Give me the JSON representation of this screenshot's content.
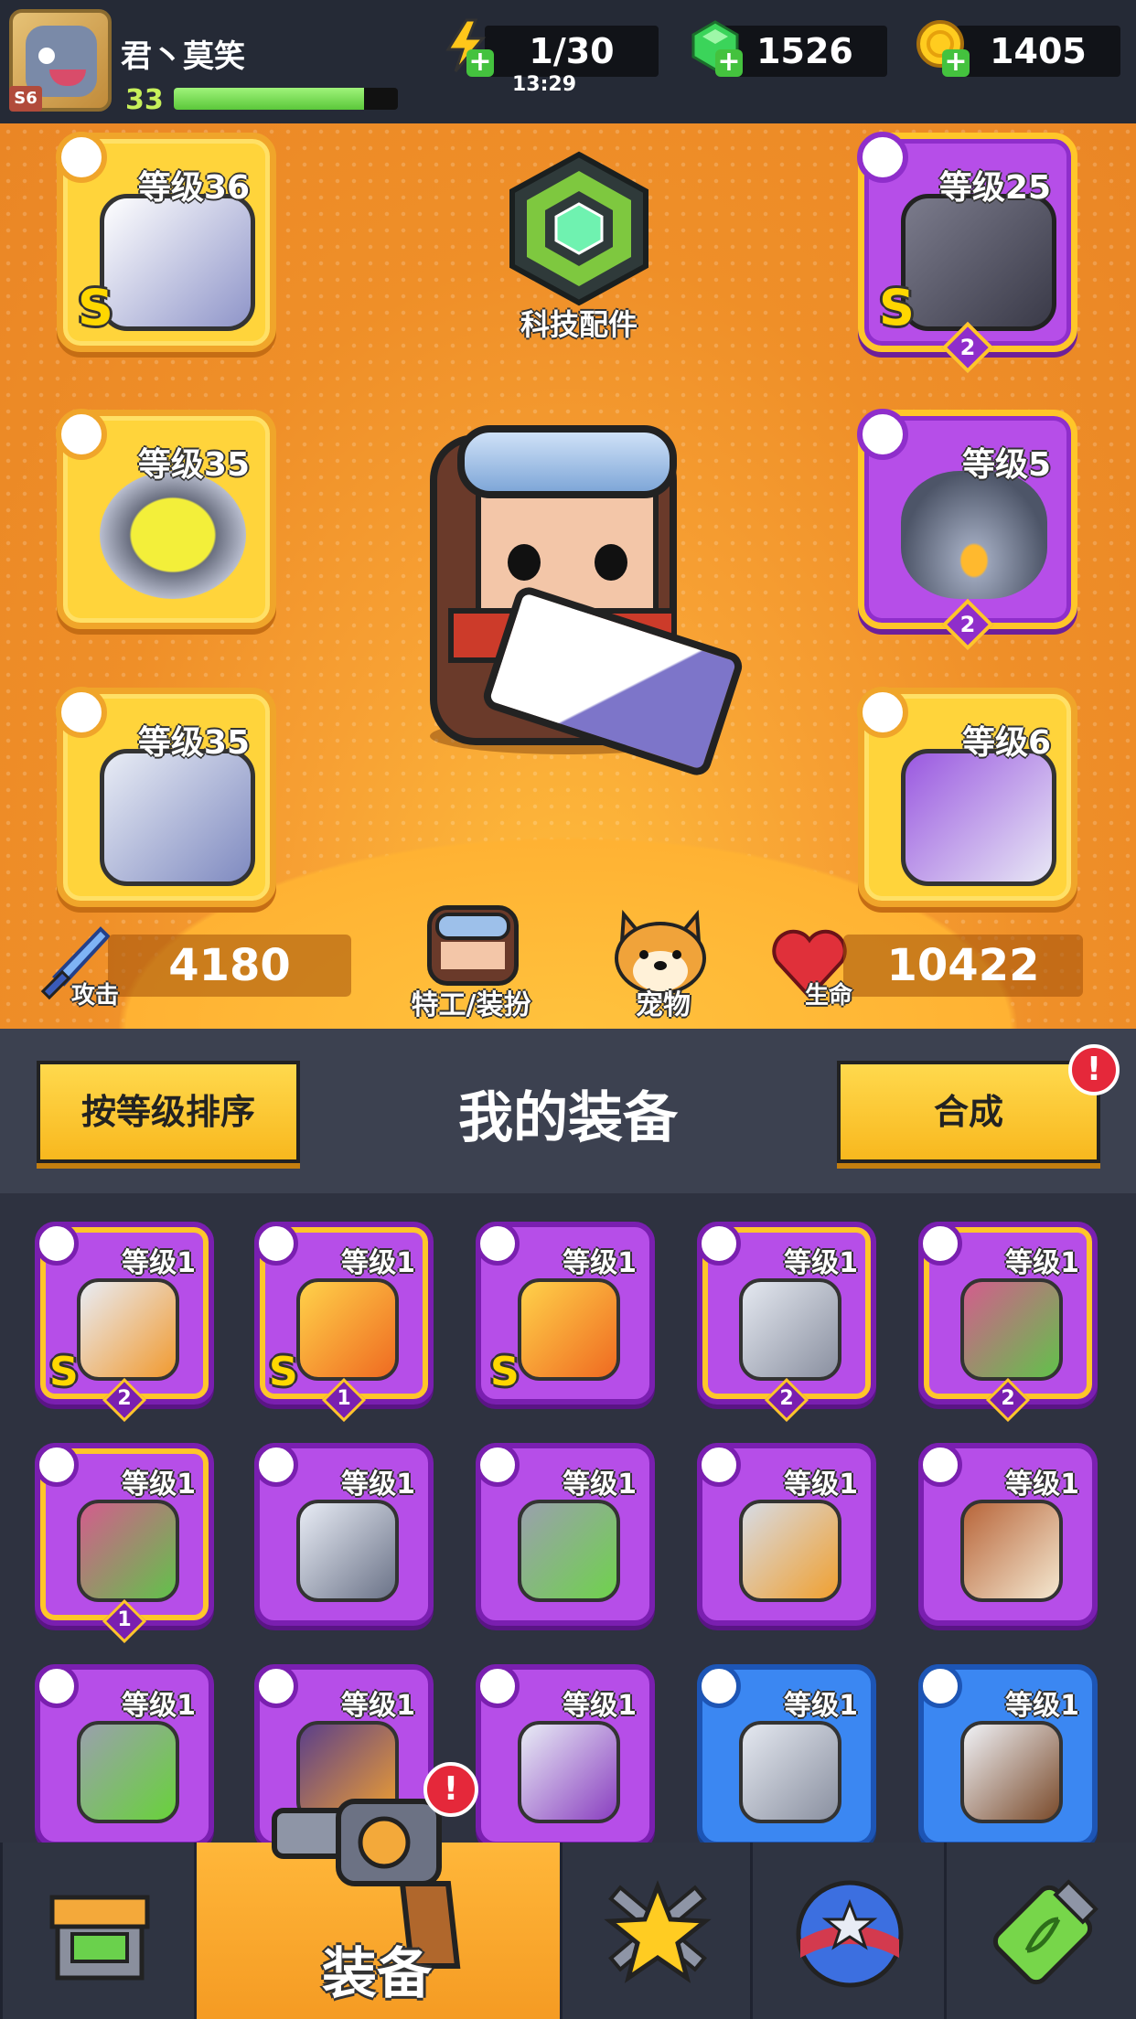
{
  "player": {
    "name": "君丶莫笑",
    "level": "33",
    "level_badge": "S6",
    "xp_fraction": 0.85
  },
  "resources": {
    "energy": {
      "value": "1/30",
      "timer": "13:29",
      "icon": "lightning-icon"
    },
    "gems": {
      "value": "1526",
      "icon": "green-gem-icon"
    },
    "coins": {
      "value": "1405",
      "icon": "gold-coin-icon"
    }
  },
  "equipped": {
    "weapon": {
      "level": "等级36",
      "rank": "S",
      "icon": "blaster-gun"
    },
    "armor": {
      "level": "等级25",
      "rank": "S",
      "stars": "2",
      "icon": "dark-armor"
    },
    "necklace": {
      "level": "等级35",
      "icon": "spiked-collar"
    },
    "belt": {
      "level": "等级5",
      "stars": "2",
      "icon": "star-belt"
    },
    "gloves": {
      "level": "等级35",
      "icon": "metal-gauntlet"
    },
    "boots": {
      "level": "等级6",
      "icon": "purple-boots"
    }
  },
  "tech_parts": {
    "label": "科技配件"
  },
  "stats": {
    "attack": {
      "label": "攻击",
      "value": "4180"
    },
    "hp": {
      "label": "生命",
      "value": "10422"
    }
  },
  "buttons": {
    "agent_outfit": "特工/装扮",
    "pet": "宠物",
    "sort": "按等级排序",
    "merge": "合成"
  },
  "inventory": {
    "title": "我的装备",
    "items": [
      {
        "level": "等级1",
        "rank": "S",
        "stars": "2",
        "type": "armor",
        "color": "purple",
        "outlined": true,
        "icon": "mech-armor"
      },
      {
        "level": "等级1",
        "rank": "S",
        "stars": "1",
        "type": "weapon",
        "color": "purple",
        "outlined": true,
        "icon": "flame-sword"
      },
      {
        "level": "等级1",
        "rank": "S",
        "type": "weapon",
        "color": "purple",
        "outlined": false,
        "icon": "flame-sword"
      },
      {
        "level": "等级1",
        "stars": "2",
        "type": "weapon",
        "color": "purple",
        "outlined": true,
        "icon": "kunai"
      },
      {
        "level": "等级1",
        "stars": "2",
        "type": "boots",
        "color": "purple",
        "outlined": true,
        "icon": "claw-boots"
      },
      {
        "level": "等级1",
        "stars": "1",
        "type": "boots",
        "color": "purple",
        "outlined": true,
        "icon": "claw-boots"
      },
      {
        "level": "等级1",
        "type": "armor",
        "color": "purple",
        "outlined": false,
        "icon": "silver-jacket"
      },
      {
        "level": "等级1",
        "type": "armor",
        "color": "purple",
        "outlined": false,
        "icon": "gem-armor"
      },
      {
        "level": "等级1",
        "type": "armor",
        "color": "purple",
        "outlined": false,
        "icon": "plate-armor"
      },
      {
        "level": "等级1",
        "type": "necklace",
        "color": "purple",
        "outlined": false,
        "icon": "fang-necklace"
      },
      {
        "level": "等级1",
        "type": "necklace",
        "color": "purple",
        "outlined": false,
        "icon": "gem-necklace"
      },
      {
        "level": "等级1",
        "type": "belt",
        "color": "purple",
        "outlined": false,
        "icon": "tech-belt"
      },
      {
        "level": "等级1",
        "type": "gloves",
        "color": "purple",
        "outlined": false,
        "icon": "claw-gauntlet"
      },
      {
        "level": "等级1",
        "type": "weapon",
        "color": "blue",
        "outlined": false,
        "icon": "kunai"
      },
      {
        "level": "等级1",
        "type": "weapon",
        "color": "blue",
        "outlined": false,
        "icon": "katana"
      }
    ]
  },
  "nav": {
    "tabs": [
      {
        "name": "shop",
        "icon": "shop-icon"
      },
      {
        "name": "equipment",
        "label": "装备",
        "icon": "revolver-icon",
        "active": true
      },
      {
        "name": "battle",
        "icon": "crossed-swords-star-icon"
      },
      {
        "name": "events",
        "icon": "star-ball-icon"
      },
      {
        "name": "evolve",
        "icon": "dna-capsule-icon"
      }
    ]
  },
  "colors": {
    "purple_item": "#b64ee8",
    "blue_item": "#3b87f2",
    "gold_slot": "#ffd43b",
    "hero_bg": "#f7a033"
  }
}
